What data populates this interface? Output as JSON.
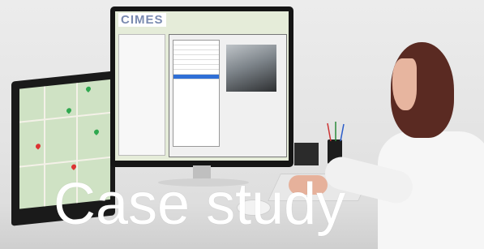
{
  "overlay": {
    "caption": "Case study"
  },
  "screen": {
    "brand": "CIMES"
  },
  "colors": {
    "hair": "#5a2a22",
    "shirt": "#f6f6f6",
    "map": "#cfe2c4",
    "brand": "#7a8bb0",
    "caption": "#ffffff"
  }
}
